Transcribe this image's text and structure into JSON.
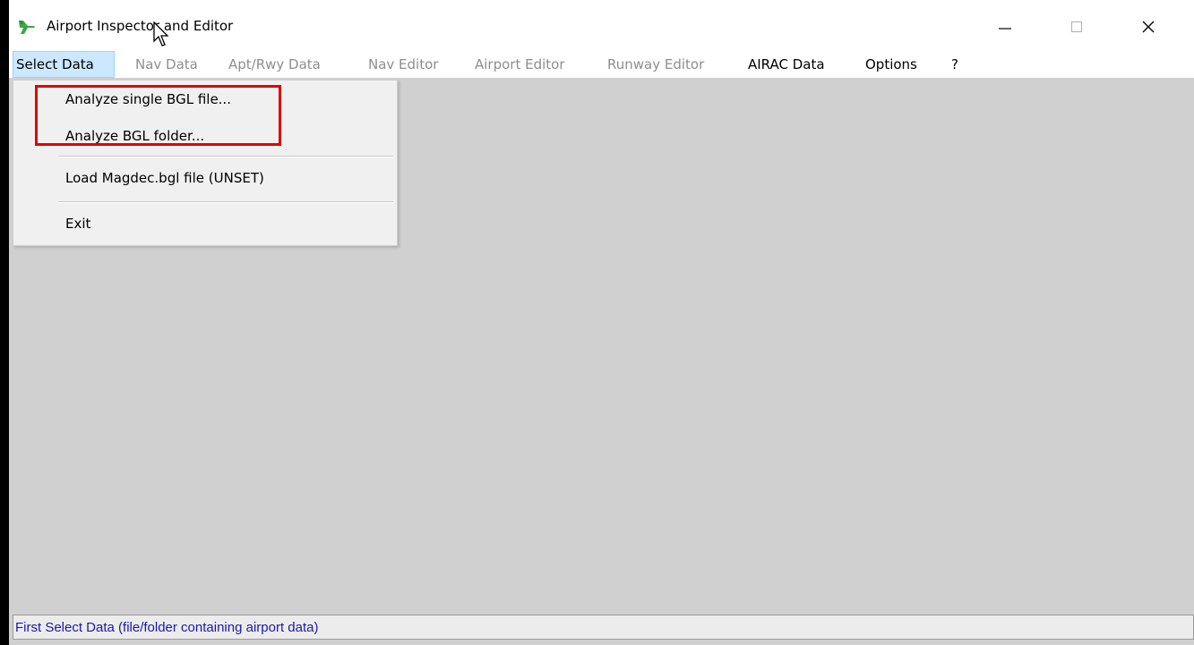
{
  "window": {
    "title": "Airport Inspector and Editor",
    "icon": "green-airplane-icon",
    "controls": {
      "minimize": "minimize-icon",
      "maximize": "maximize-icon",
      "close": "close-icon"
    }
  },
  "menubar": {
    "items": [
      {
        "label": "Select Data",
        "state": "active"
      },
      {
        "label": "Nav Data",
        "state": "disabled"
      },
      {
        "label": "Apt/Rwy Data",
        "state": "disabled"
      },
      {
        "label": "Nav Editor",
        "state": "disabled"
      },
      {
        "label": "Airport Editor",
        "state": "disabled"
      },
      {
        "label": "Runway Editor",
        "state": "disabled"
      },
      {
        "label": "AIRAC Data",
        "state": "enabled"
      },
      {
        "label": "Options",
        "state": "enabled"
      },
      {
        "label": "?",
        "state": "enabled"
      }
    ]
  },
  "dropdown": {
    "items": [
      {
        "label": "Analyze single BGL file..."
      },
      {
        "label": "Analyze BGL folder..."
      },
      {
        "label": "Load Magdec.bgl file (UNSET)"
      },
      {
        "label": "Exit"
      }
    ]
  },
  "statusbar": {
    "text": "First Select Data (file/folder containing airport data)"
  },
  "colors": {
    "client_background": "#d0d0d0",
    "menu_active": "#cce8ff",
    "highlight_box": "#e00000",
    "status_text": "#1a1aa8",
    "disabled_text": "#8e8e8e"
  }
}
